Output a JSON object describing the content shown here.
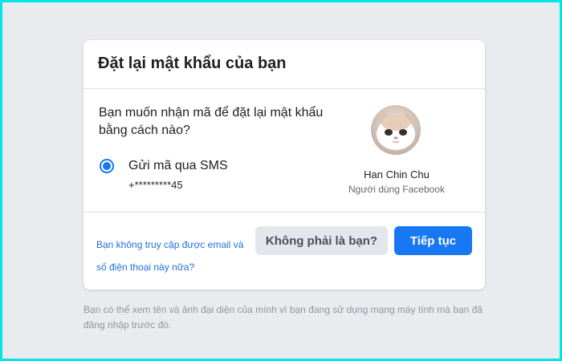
{
  "card": {
    "title": "Đặt lại mật khẩu của bạn",
    "question": "Bạn muốn nhận mã để đặt lại mật khẩu bằng cách nào?",
    "option": {
      "label": "Gửi mã qua SMS",
      "phone": "+*********45",
      "selected": true
    },
    "user": {
      "name": "Han Chin Chu",
      "subtitle": "Người dùng Facebook",
      "avatar_icon": "cat-avatar-icon"
    },
    "link_text": "Bạn không truy cập được email và số điện thoại này nữa?",
    "secondary_button": "Không phải là bạn?",
    "primary_button": "Tiếp tục"
  },
  "footnote": "Bạn có thể xem tên và ảnh đại diện của mình vì bạn đang sử dụng mạng máy tính mà bạn đã đăng nhập trước đó.",
  "colors": {
    "accent": "#1877f2",
    "background": "#e9ebee",
    "frame_border": "#00e6e6",
    "link": "#216fdb"
  }
}
